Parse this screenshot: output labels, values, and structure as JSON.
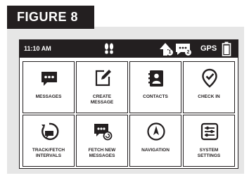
{
  "figure_label": "FIGURE 8",
  "status_bar": {
    "time": "11:10 AM",
    "gps": "GPS",
    "upload_badge": "1",
    "message_badge": "2"
  },
  "tiles": [
    {
      "label": "MESSAGES",
      "icon": "chat-bubble-icon"
    },
    {
      "label": "CREATE\nMESSAGE",
      "icon": "edit-note-icon"
    },
    {
      "label": "CONTACTS",
      "icon": "contacts-book-icon"
    },
    {
      "label": "CHECK IN",
      "icon": "check-pin-icon"
    },
    {
      "label": "TRACK/FETCH\nINTERVALS",
      "icon": "track-interval-icon"
    },
    {
      "label": "FETCH NEW\nMESSAGES",
      "icon": "fetch-messages-icon"
    },
    {
      "label": "NAVIGATION",
      "icon": "compass-icon"
    },
    {
      "label": "SYSTEM\nSETTINGS",
      "icon": "settings-sliders-icon"
    }
  ],
  "colors": {
    "dark": "#231f20",
    "panel": "#e6e6e6"
  }
}
